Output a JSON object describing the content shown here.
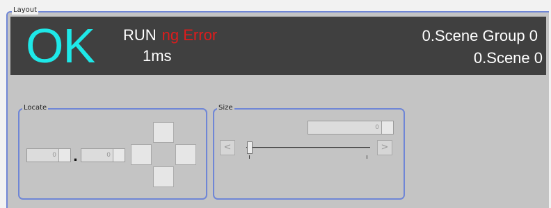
{
  "layout": {
    "title": "Layout"
  },
  "status": {
    "result": "OK",
    "run": "RUN",
    "ng": "ng Error",
    "time": "1ms",
    "scene_group": "0.Scene Group 0",
    "scene": "0.Scene 0",
    "colors": {
      "ok": "#1ee8e8",
      "ng": "#dd1c1c",
      "panel": "#404040"
    }
  },
  "locate": {
    "title": "Locate",
    "x_value": "0",
    "y_value": "0",
    "separator": "."
  },
  "size": {
    "title": "Size",
    "value": "0",
    "slider_fraction": 0.0,
    "left_arrow": "<",
    "right_arrow": ">"
  }
}
